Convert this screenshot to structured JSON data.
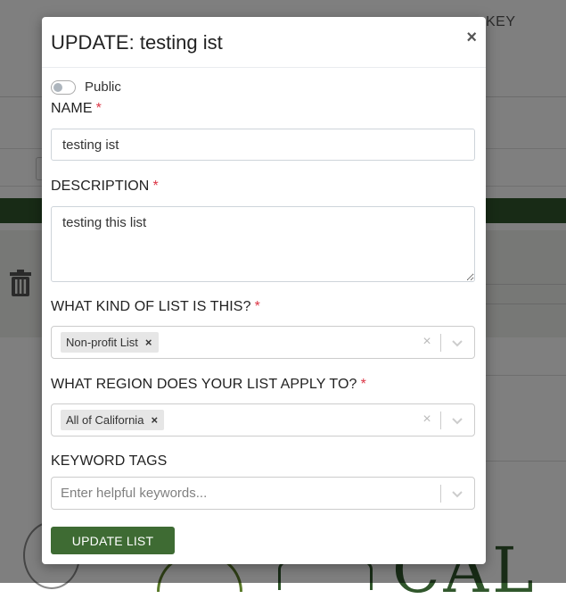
{
  "background": {
    "header_text": "KEY",
    "logo_text": "CAL"
  },
  "modal": {
    "title": "UPDATE: testing ist",
    "close_symbol": "×",
    "public_toggle": {
      "label": "Public",
      "on": false
    },
    "name": {
      "label": "NAME",
      "required_mark": "*",
      "value": "testing ist"
    },
    "description": {
      "label": "DESCRIPTION",
      "required_mark": "*",
      "value": "testing this list"
    },
    "list_kind": {
      "label": "WHAT KIND OF LIST IS THIS?",
      "required_mark": "*",
      "selected": [
        "Non-profit List"
      ],
      "remove_symbol": "×",
      "clear_symbol": "×"
    },
    "region": {
      "label": "WHAT REGION DOES YOUR LIST APPLY TO?",
      "required_mark": "*",
      "selected": [
        "All of California"
      ],
      "remove_symbol": "×",
      "clear_symbol": "×"
    },
    "keywords": {
      "label": "KEYWORD TAGS",
      "placeholder": "Enter helpful keywords..."
    },
    "submit_label": "UPDATE LIST"
  },
  "colors": {
    "primary_green": "#3e6b33",
    "required_red": "#dc3545",
    "chip_bg": "#e6e6e6"
  }
}
